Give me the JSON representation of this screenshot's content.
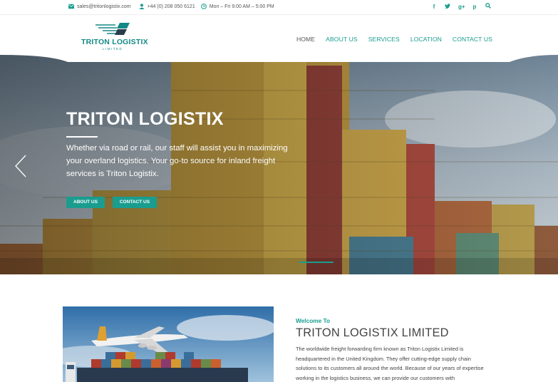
{
  "topbar": {
    "email": "sales@tritonlogistix.com",
    "phone": "+44 (0) 208 050 6121",
    "hours": "Mon – Fri 9:00 AM – 5:00 PM",
    "social": [
      "f",
      "t",
      "g+",
      "p",
      "search"
    ]
  },
  "brand": {
    "name": "TRITON LOGISTIX",
    "sub": "LIMITED"
  },
  "nav": {
    "home": "HOME",
    "about": "ABOUT US",
    "services": "SERVICES",
    "location": "LOCATION",
    "contact": "CONTACT US"
  },
  "hero": {
    "title": "TRITON LOGISTIX",
    "text": "Whether via road or rail, our staff will assist you in maximizing your overland logistics. Your go-to source for inland freight services is Triton Logistix.",
    "btn_about": "ABOUT US",
    "btn_contact": "CONTACT US"
  },
  "about": {
    "welcome": "Welcome To",
    "title": "TRITON LOGISTIX LIMITED",
    "text": "The worldwide freight forwarding firm known as Triton Logistix Limited is headquartered in the United Kingdom. They offer cutting-edge supply chain solutions to its customers all around the world. Because of our years of expertise working in the logistics business, we can provide our customers with"
  },
  "colors": {
    "accent": "#1a9d8f",
    "brand": "#138a86"
  },
  "icons": {
    "email": "email-icon",
    "phone": "user-icon",
    "hours": "clock-icon",
    "slider_prev": "chevron-left-icon"
  }
}
